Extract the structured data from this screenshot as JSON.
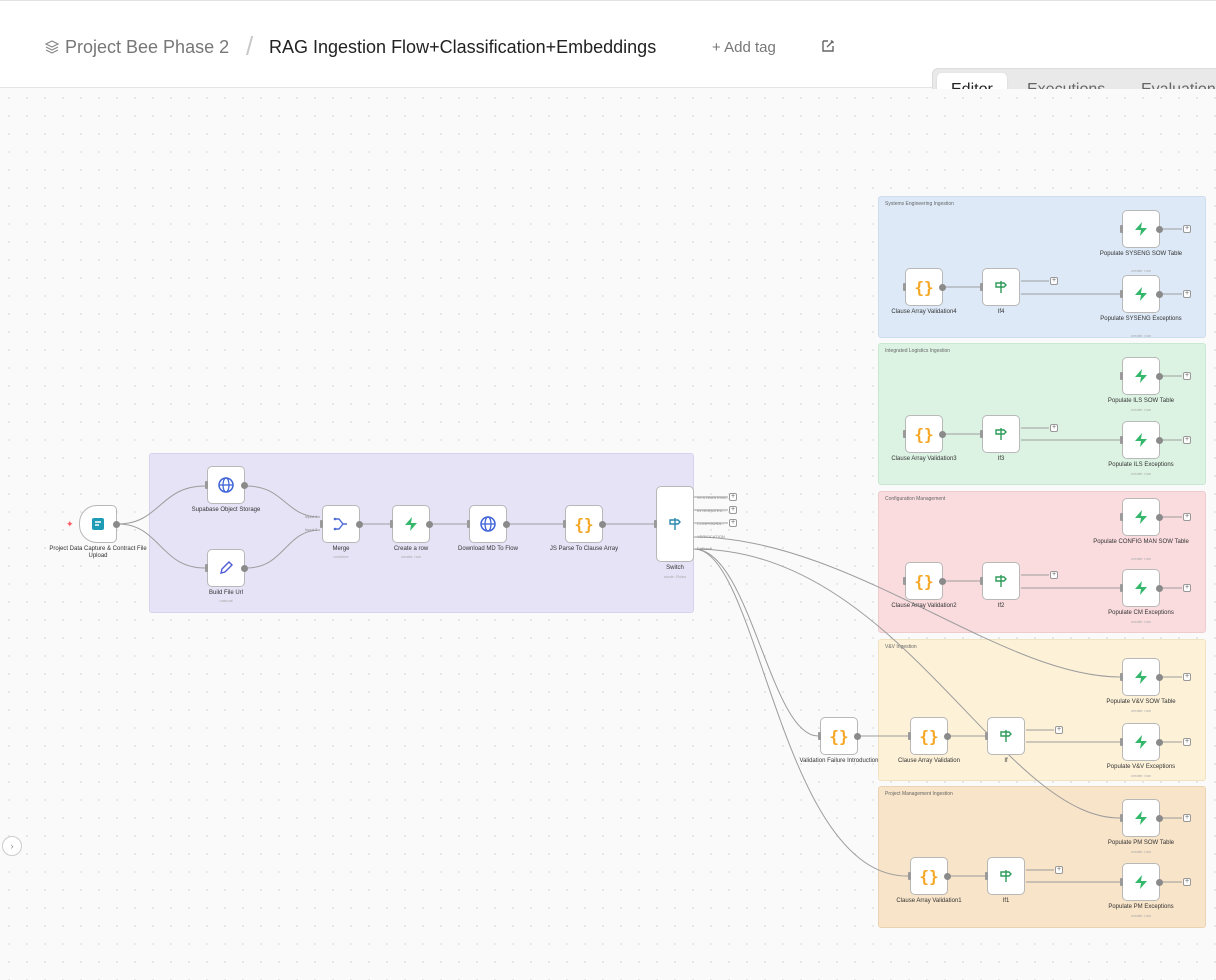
{
  "header": {
    "project_name": "Project Bee Phase 2",
    "separator": "/",
    "workflow_name": "RAG Ingestion Flow+Classification+Embeddings",
    "add_tag_label": "+ Add tag"
  },
  "tabs": [
    "Editor",
    "Executions",
    "Evaluations"
  ],
  "active_tab": "Editor",
  "groups": {
    "systems_engineering": "Systems Engineering Ingestion",
    "ils": "Integrated Logistics Ingestion",
    "config_mgmt": "Configuration Management",
    "vv": "V&V Ingestion",
    "pm": "Project Management Ingestion"
  },
  "nodes": {
    "trigger": {
      "label": "Project Data Capture & Contract File Upload"
    },
    "supabase": {
      "label": "Supabase Object Storage"
    },
    "build_url": {
      "label": "Build File Url",
      "sub": "manual"
    },
    "merge": {
      "label": "Merge",
      "sub": "combine"
    },
    "create_row": {
      "label": "Create a row",
      "sub": "create: row"
    },
    "download_md": {
      "label": "Download MD To Flow"
    },
    "js_parse": {
      "label": "JS Parse To Clause Array"
    },
    "switch": {
      "label": "Switch",
      "sub": "mode: Rules"
    },
    "cav4": {
      "label": "Clause Array Validation4"
    },
    "if4": {
      "label": "If4"
    },
    "sys_sow": {
      "label": "Populate SYSENG SOW Table",
      "sub": "create: row"
    },
    "sys_exc": {
      "label": "Populate SYSENG Exceptions",
      "sub": "create: row"
    },
    "cav3": {
      "label": "Clause Array Validation3"
    },
    "if3": {
      "label": "If3"
    },
    "ils_sow": {
      "label": "Populate ILS SOW Table",
      "sub": "create: row"
    },
    "ils_exc": {
      "label": "Populate ILS Exceptions",
      "sub": "create: row"
    },
    "cav2": {
      "label": "Clause Array Validation2"
    },
    "if2": {
      "label": "If2"
    },
    "cm_sow": {
      "label": "Populate CONFIG MAN SOW Table",
      "sub": "create: row"
    },
    "cm_exc": {
      "label": "Populate CM Exceptions",
      "sub": "create: row"
    },
    "vfi": {
      "label": "Validation Failure Introduction"
    },
    "cav": {
      "label": "Clause Array Validation"
    },
    "if": {
      "label": "If"
    },
    "vv_sow": {
      "label": "Populate V&V SOW Table",
      "sub": "create: row"
    },
    "vv_exc": {
      "label": "Populate V&V Exceptions",
      "sub": "create: row"
    },
    "cav1": {
      "label": "Clause Array Validation1"
    },
    "if1": {
      "label": "If1"
    },
    "pm_sow": {
      "label": "Populate PM SOW Table",
      "sub": "create: row"
    },
    "pm_exc": {
      "label": "Populate PM Exceptions",
      "sub": "create: row"
    }
  },
  "switch_outputs": [
    "SYSTEMS ENG...",
    "INTEGRATED...",
    "CONFIGURA...",
    "VERIFICATION",
    "Fallback"
  ],
  "merge_inputs": [
    "Input 1",
    "Input 2"
  ],
  "if_outputs": [
    "true",
    "false"
  ],
  "colors": {
    "accent": "#ff6d5a",
    "group_main": "#e6e3f6",
    "group_syseng": "#dde9f7",
    "group_ils": "#dcf3e3",
    "group_cm": "#fadcdf",
    "group_vv": "#fdf1d8",
    "group_pm": "#f8e4c8"
  }
}
